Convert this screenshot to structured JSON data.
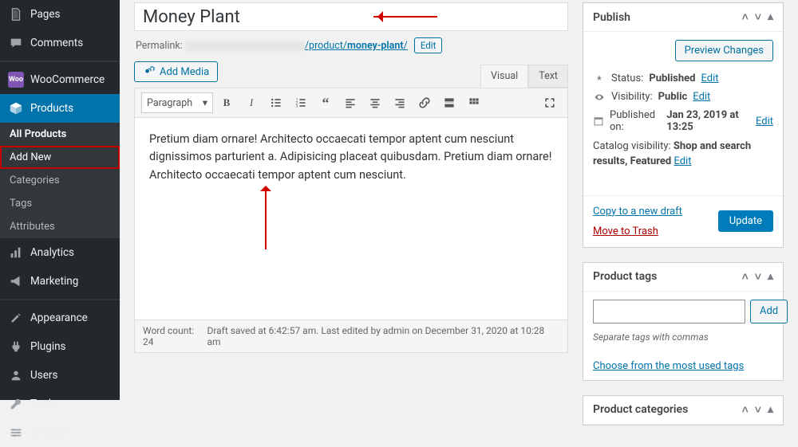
{
  "sidebar": {
    "pages": "Pages",
    "comments": "Comments",
    "woocommerce": "WooCommerce",
    "products": "Products",
    "sub": {
      "all": "All Products",
      "add": "Add New",
      "categories": "Categories",
      "tags": "Tags",
      "attributes": "Attributes"
    },
    "analytics": "Analytics",
    "marketing": "Marketing",
    "appearance": "Appearance",
    "plugins": "Plugins",
    "users": "Users",
    "tools": "Tools",
    "settings": "Settings"
  },
  "title": "Money Plant",
  "permalink": {
    "label": "Permalink:",
    "path": "/product/",
    "slug": "money-plant",
    "trail": "/",
    "edit": "Edit"
  },
  "add_media": "Add Media",
  "editor_tabs": {
    "visual": "Visual",
    "text": "Text"
  },
  "paragraph_select": "Paragraph",
  "body_text": "Pretium diam ornare! Architecto occaecati tempor aptent cum nesciunt dignissimos parturient a. Adipisicing placeat quibusdam. Pretium diam ornare! Architecto occaecati tempor aptent cum nesciunt.",
  "statusbar": {
    "wordcount": "Word count: 24",
    "draft": "Draft saved at 6:42:57 am. Last edited by admin on December 31, 2020 at 10:28 am"
  },
  "publish_box": {
    "title": "Publish",
    "preview": "Preview Changes",
    "status_label": "Status:",
    "status_value": "Published",
    "visibility_label": "Visibility:",
    "visibility_value": "Public",
    "published_label": "Published on:",
    "published_value": "Jan 23, 2019 at 13:25",
    "catalog_label": "Catalog visibility:",
    "catalog_value": "Shop and search results, Featured",
    "edit": "Edit",
    "copy": "Copy to a new draft",
    "trash": "Move to Trash",
    "update": "Update"
  },
  "tags_box": {
    "title": "Product tags",
    "add": "Add",
    "hint": "Separate tags with commas",
    "choose": "Choose from the most used tags"
  },
  "cats_box": {
    "title": "Product categories"
  }
}
